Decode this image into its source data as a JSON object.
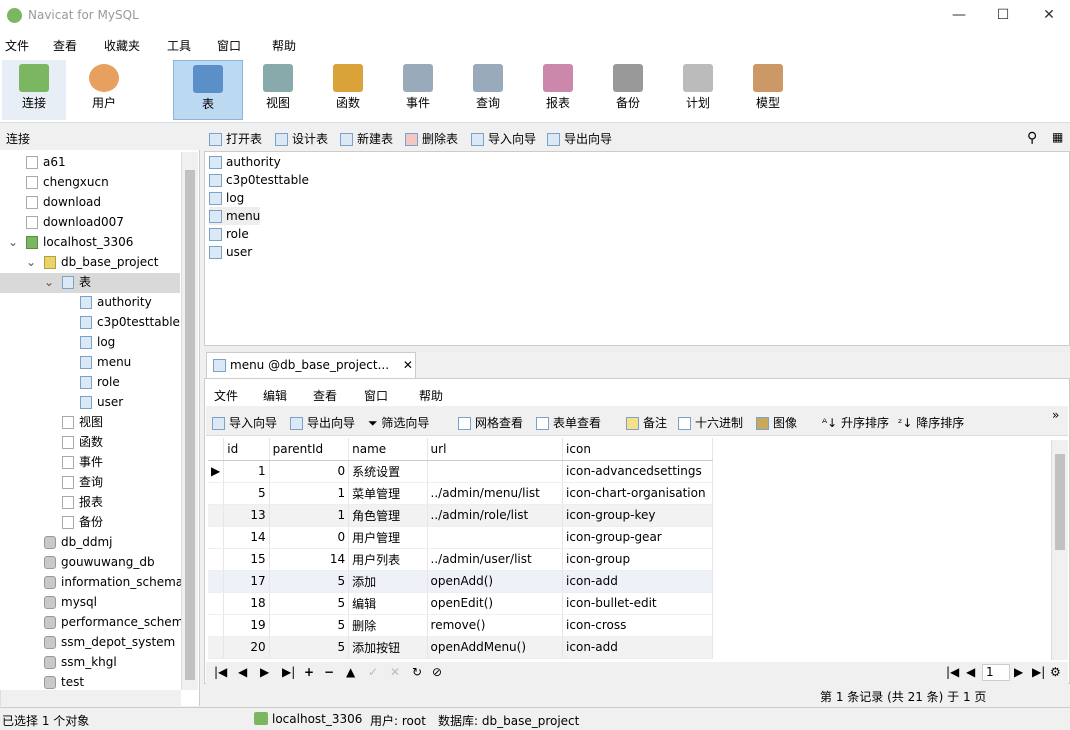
{
  "window": {
    "title": "Navicat for MySQL",
    "min": "—",
    "max": "☐",
    "close": "✕"
  },
  "menu": [
    "文件",
    "查看",
    "收藏夹",
    "工具",
    "窗口",
    "帮助"
  ],
  "toolbar": [
    {
      "label": "连接",
      "icon": "connection-icon",
      "color": "#7bb661"
    },
    {
      "label": "用户",
      "icon": "user-icon",
      "color": "#e8a060"
    },
    {
      "label": "表",
      "icon": "table-icon",
      "color": "#5b8fc7"
    },
    {
      "label": "视图",
      "icon": "view-icon",
      "color": "#8aa"
    },
    {
      "label": "函数",
      "icon": "function-icon",
      "color": "#d9a33a"
    },
    {
      "label": "事件",
      "icon": "event-icon",
      "color": "#9ab"
    },
    {
      "label": "查询",
      "icon": "query-icon",
      "color": "#9ab"
    },
    {
      "label": "报表",
      "icon": "report-icon",
      "color": "#c8a"
    },
    {
      "label": "备份",
      "icon": "backup-icon",
      "color": "#999"
    },
    {
      "label": "计划",
      "icon": "schedule-icon",
      "color": "#bbb"
    },
    {
      "label": "模型",
      "icon": "model-icon",
      "color": "#c96"
    }
  ],
  "left": {
    "header": "连接",
    "tree": [
      {
        "label": "a61",
        "type": "conn-off",
        "indent": 0
      },
      {
        "label": "chengxucn",
        "type": "conn-off",
        "indent": 0
      },
      {
        "label": "download",
        "type": "conn-off",
        "indent": 0
      },
      {
        "label": "download007",
        "type": "conn-off",
        "indent": 0
      },
      {
        "label": "localhost_3306",
        "type": "conn",
        "indent": 0
      },
      {
        "label": "db_base_project",
        "type": "dbo",
        "indent": 1
      },
      {
        "label": "表",
        "type": "tbl",
        "indent": 2
      },
      {
        "label": "authority",
        "type": "tbl",
        "indent": 3
      },
      {
        "label": "c3p0testtable",
        "type": "tbl",
        "indent": 3
      },
      {
        "label": "log",
        "type": "tbl",
        "indent": 3
      },
      {
        "label": "menu",
        "type": "tbl",
        "indent": 3
      },
      {
        "label": "role",
        "type": "tbl",
        "indent": 3
      },
      {
        "label": "user",
        "type": "tbl",
        "indent": 3
      },
      {
        "label": "视图",
        "type": "misc",
        "indent": 2
      },
      {
        "label": "函数",
        "type": "misc",
        "indent": 2
      },
      {
        "label": "事件",
        "type": "misc",
        "indent": 2
      },
      {
        "label": "查询",
        "type": "misc",
        "indent": 2
      },
      {
        "label": "报表",
        "type": "misc",
        "indent": 2
      },
      {
        "label": "备份",
        "type": "misc",
        "indent": 2
      },
      {
        "label": "db_ddmj",
        "type": "db",
        "indent": 1
      },
      {
        "label": "gouwuwang_db",
        "type": "db",
        "indent": 1
      },
      {
        "label": "information_schema",
        "type": "db",
        "indent": 1
      },
      {
        "label": "mysql",
        "type": "db",
        "indent": 1
      },
      {
        "label": "performance_schem",
        "type": "db",
        "indent": 1
      },
      {
        "label": "ssm_depot_system",
        "type": "db",
        "indent": 1
      },
      {
        "label": "ssm_khgl",
        "type": "db",
        "indent": 1
      },
      {
        "label": "test",
        "type": "db",
        "indent": 1
      }
    ]
  },
  "objbar": [
    "打开表",
    "设计表",
    "新建表",
    "删除表",
    "导入向导",
    "导出向导"
  ],
  "objects": [
    "authority",
    "c3p0testtable",
    "log",
    "menu",
    "role",
    "user"
  ],
  "tab": {
    "label": "menu @db_base_project...",
    "close": "✕"
  },
  "inner_menu": [
    "文件",
    "编辑",
    "查看",
    "窗口",
    "帮助"
  ],
  "inner_tools": [
    "导入向导",
    "导出向导",
    "筛选向导",
    "网格查看",
    "表单查看",
    "备注",
    "十六进制",
    "图像",
    "升序排序",
    "降序排序"
  ],
  "grid": {
    "columns": [
      "id",
      "parentId",
      "name",
      "url",
      "icon"
    ],
    "rows": [
      [
        "1",
        "0",
        "系统设置",
        "",
        "icon-advancedsettings"
      ],
      [
        "5",
        "1",
        "菜单管理",
        "../admin/menu/list",
        "icon-chart-organisation"
      ],
      [
        "13",
        "1",
        "角色管理",
        "../admin/role/list",
        "icon-group-key"
      ],
      [
        "14",
        "0",
        "用户管理",
        "",
        "icon-group-gear"
      ],
      [
        "15",
        "14",
        "用户列表",
        "../admin/user/list",
        "icon-group"
      ],
      [
        "17",
        "5",
        "添加",
        "openAdd()",
        "icon-add"
      ],
      [
        "18",
        "5",
        "编辑",
        "openEdit()",
        "icon-bullet-edit"
      ],
      [
        "19",
        "5",
        "删除",
        "remove()",
        "icon-cross"
      ],
      [
        "20",
        "5",
        "添加按钮",
        "openAddMenu()",
        "icon-add"
      ]
    ]
  },
  "nav": {
    "buttons": [
      "|◀",
      "◀",
      "▶",
      "▶|",
      "+",
      "−",
      "▲",
      "✓",
      "✕",
      "↻",
      "⊘"
    ],
    "page": "1"
  },
  "record": "第 1 条记录 (共 21 条) 于 1 页",
  "status": {
    "selection": "已选择 1 个对象",
    "conn": "localhost_3306",
    "user": "用户: root",
    "db": "数据库: db_base_project"
  }
}
